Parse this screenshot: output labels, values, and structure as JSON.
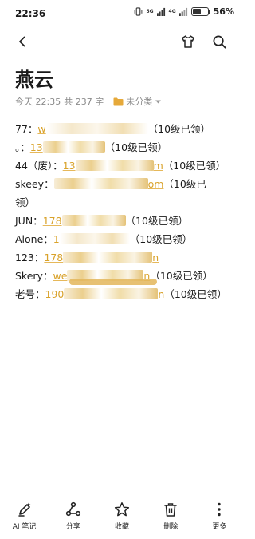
{
  "status": {
    "time": "22:36",
    "net1": "5G",
    "net2": "4G",
    "battery_text": "56%",
    "battery_level": 0.56
  },
  "nav": {
    "back_icon": "back-arrow-icon",
    "theme_icon": "tshirt-icon",
    "search_icon": "search-icon"
  },
  "note": {
    "title": "燕云",
    "date": "今天 22:35",
    "word_count": "共 237 字",
    "folder": "未分类"
  },
  "entries": [
    {
      "label": "77：",
      "link_start": "w",
      "tail": "（10级已领）"
    },
    {
      "label": "。：",
      "link_start": "13",
      "tail": "（10级已领）"
    },
    {
      "label": "44（废）：",
      "link_start": "13",
      "link_end": "m",
      "tail": "（10级已领）"
    },
    {
      "label": "skeey：",
      "link_end": "om",
      "tail": "（10级已"
    },
    {
      "label": "",
      "tail": "领）"
    },
    {
      "label": "JUN：",
      "link_start": "178",
      "tail": "（10级已领）"
    },
    {
      "label": "Alone：",
      "link_start": "1",
      "tail": "（10级已领）"
    },
    {
      "label": "123：",
      "link_start": "178",
      "link_end": "n",
      "tail": ""
    },
    {
      "label": "Skery：",
      "link_start": "we",
      "link_end": "n",
      "tail": "（10级已领）"
    },
    {
      "label": "老号：",
      "link_start": "190",
      "link_end": "n",
      "tail": "（10级已领）"
    }
  ],
  "toolbar": [
    {
      "label": "AI 笔记",
      "icon": "ai-pen-icon"
    },
    {
      "label": "分享",
      "icon": "share-icon"
    },
    {
      "label": "收藏",
      "icon": "star-icon"
    },
    {
      "label": "删除",
      "icon": "trash-icon"
    },
    {
      "label": "更多",
      "icon": "more-icon"
    }
  ],
  "colors": {
    "accent": "#d9a22a",
    "text": "#1a1a1a",
    "meta": "#8a8a8a"
  }
}
